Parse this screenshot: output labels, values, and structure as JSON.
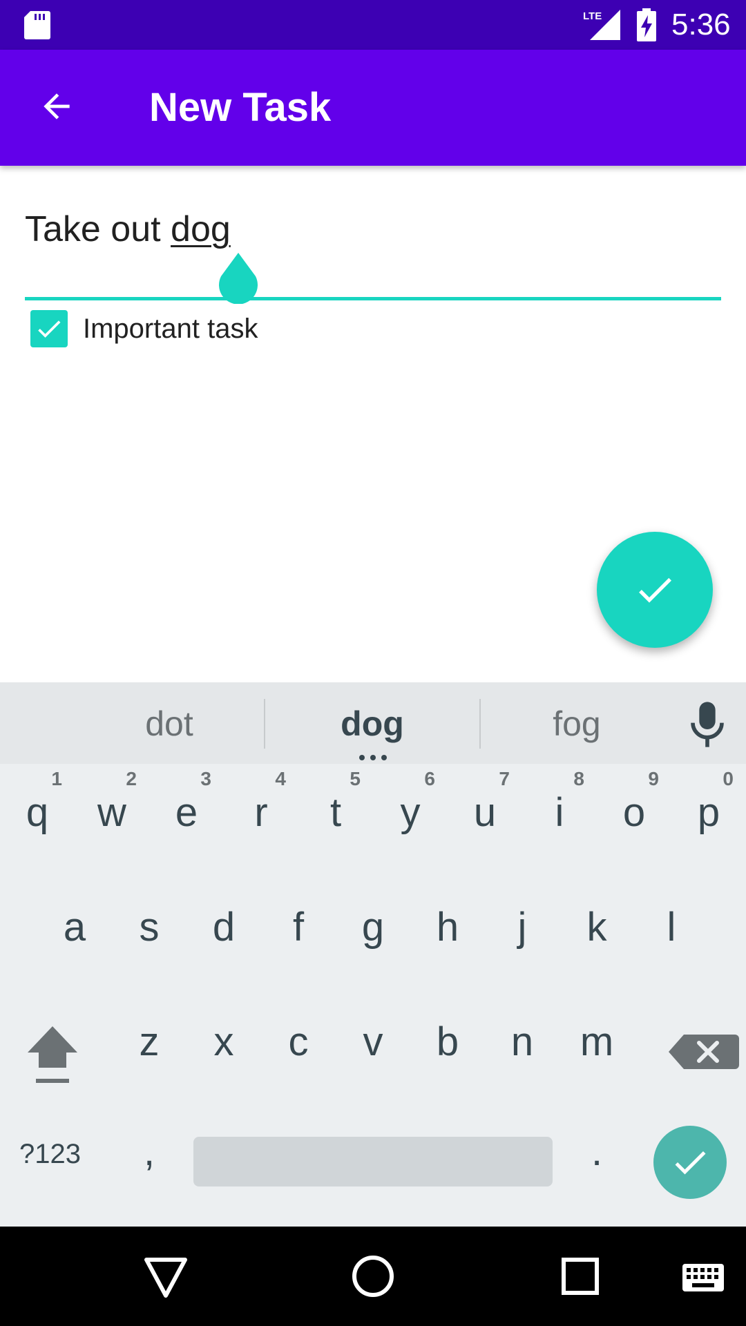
{
  "status_bar": {
    "time": "5:36",
    "icons": [
      "sd-card-icon",
      "lte-signal-icon",
      "battery-charging-icon"
    ]
  },
  "app_bar": {
    "title": "New Task",
    "back_icon": "arrow-back-icon"
  },
  "task": {
    "text_prefix": "Take out ",
    "text_word": "dog",
    "important_label": "Important task",
    "important_checked": true
  },
  "fab": {
    "icon": "check-icon"
  },
  "keyboard": {
    "suggestions": [
      "dot",
      "dog",
      "fog"
    ],
    "rows": [
      [
        {
          "letter": "q",
          "hint": "1"
        },
        {
          "letter": "w",
          "hint": "2"
        },
        {
          "letter": "e",
          "hint": "3"
        },
        {
          "letter": "r",
          "hint": "4"
        },
        {
          "letter": "t",
          "hint": "5"
        },
        {
          "letter": "y",
          "hint": "6"
        },
        {
          "letter": "u",
          "hint": "7"
        },
        {
          "letter": "i",
          "hint": "8"
        },
        {
          "letter": "o",
          "hint": "9"
        },
        {
          "letter": "p",
          "hint": "0"
        }
      ],
      [
        {
          "letter": "a"
        },
        {
          "letter": "s"
        },
        {
          "letter": "d"
        },
        {
          "letter": "f"
        },
        {
          "letter": "g"
        },
        {
          "letter": "h"
        },
        {
          "letter": "j"
        },
        {
          "letter": "k"
        },
        {
          "letter": "l"
        }
      ],
      [
        {
          "letter": "z"
        },
        {
          "letter": "x"
        },
        {
          "letter": "c"
        },
        {
          "letter": "v"
        },
        {
          "letter": "b"
        },
        {
          "letter": "n"
        },
        {
          "letter": "m"
        }
      ]
    ],
    "symbols_label": "?123",
    "comma_label": ",",
    "period_label": "."
  },
  "colors": {
    "status_bar": "#3d00b3",
    "app_bar": "#6200ea",
    "accent": "#18d5c0",
    "keyboard_bg": "#eceff1",
    "enter_key": "#4db6ac"
  }
}
